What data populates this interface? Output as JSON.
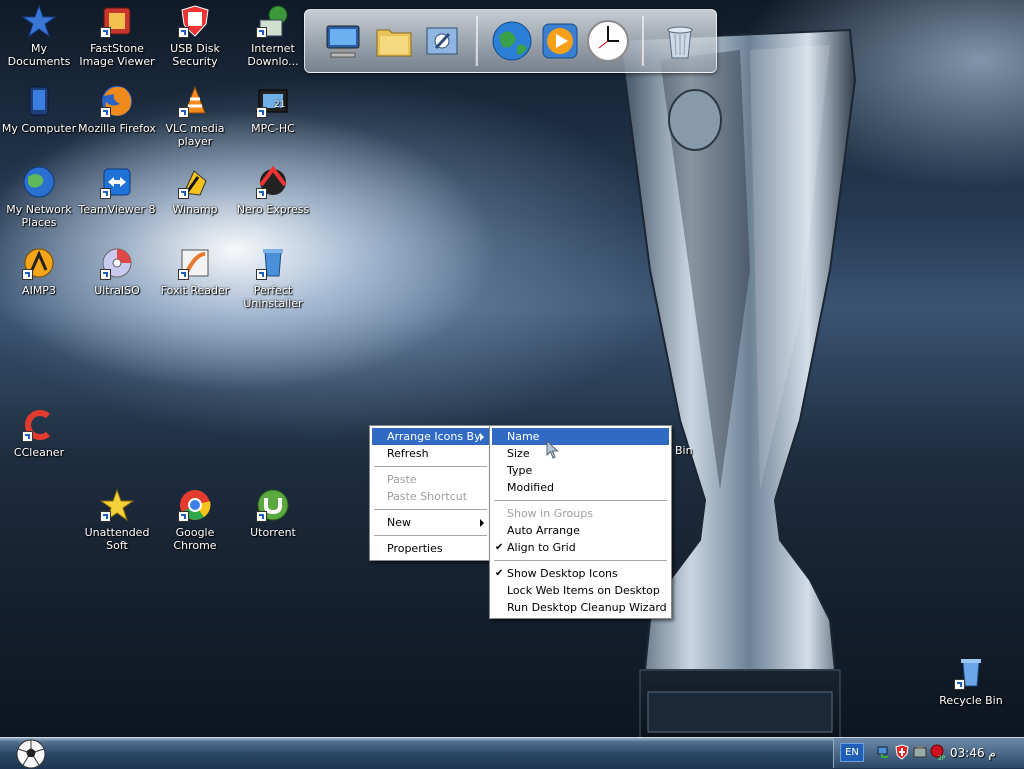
{
  "desktop_icons": [
    {
      "label": "My Documents",
      "icon": "star-icon"
    },
    {
      "label": "FastStone Image Viewer",
      "icon": "image-viewer-icon"
    },
    {
      "label": "USB Disk Security",
      "icon": "shield-icon"
    },
    {
      "label": "Internet Downlo...",
      "icon": "download-globe-icon"
    },
    {
      "label": "My Computer",
      "icon": "computer-icon"
    },
    {
      "label": "Mozilla Firefox",
      "icon": "firefox-icon"
    },
    {
      "label": "VLC media player",
      "icon": "vlc-cone-icon"
    },
    {
      "label": "MPC-HC",
      "icon": "film-icon"
    },
    {
      "label": "My Network Places",
      "icon": "network-globe-icon"
    },
    {
      "label": "TeamViewer 8",
      "icon": "teamviewer-icon"
    },
    {
      "label": "Winamp",
      "icon": "winamp-icon"
    },
    {
      "label": "Nero Express",
      "icon": "nero-icon"
    },
    {
      "label": "AIMP3",
      "icon": "aimp-icon"
    },
    {
      "label": "UltraISO",
      "icon": "disc-icon"
    },
    {
      "label": "Foxit Reader",
      "icon": "foxit-icon"
    },
    {
      "label": "Perfect Uninstaller",
      "icon": "uninstaller-icon"
    },
    {
      "label": "CCleaner",
      "icon": "ccleaner-icon"
    },
    {
      "label": "Unattended Soft",
      "icon": "star-shortcut-icon"
    },
    {
      "label": "Google Chrome",
      "icon": "chrome-icon"
    },
    {
      "label": "Utorrent",
      "icon": "utorrent-icon"
    },
    {
      "label": "Recycle Bin",
      "icon": "recycle-bin-icon"
    }
  ],
  "partial_icon_label": "Bin",
  "dock": {
    "items": [
      "computer-icon",
      "folder-icon",
      "control-panel-icon",
      "globe-icon",
      "media-player-icon",
      "clock-icon",
      "recycle-bin-icon"
    ]
  },
  "context_menu": {
    "items": [
      {
        "label": "Arrange Icons By",
        "state": "highlighted",
        "submenu": true
      },
      {
        "label": "Refresh",
        "state": "enabled"
      },
      {
        "label": "Paste",
        "state": "disabled"
      },
      {
        "label": "Paste Shortcut",
        "state": "disabled"
      },
      {
        "label": "New",
        "state": "enabled",
        "submenu": true
      },
      {
        "label": "Properties",
        "state": "enabled"
      }
    ]
  },
  "submenu": {
    "items": [
      {
        "label": "Name",
        "state": "highlighted"
      },
      {
        "label": "Size",
        "state": "enabled"
      },
      {
        "label": "Type",
        "state": "enabled"
      },
      {
        "label": "Modified",
        "state": "enabled"
      },
      {
        "label": "Show in Groups",
        "state": "disabled"
      },
      {
        "label": "Auto Arrange",
        "state": "enabled"
      },
      {
        "label": "Align to Grid",
        "state": "checked"
      },
      {
        "label": "Show Desktop Icons",
        "state": "checked"
      },
      {
        "label": "Lock Web Items on Desktop",
        "state": "enabled"
      },
      {
        "label": "Run Desktop Cleanup Wizard",
        "state": "enabled"
      }
    ]
  },
  "taskbar": {
    "language": "EN",
    "clock": "03:46 م",
    "tray_icons": [
      "network-icon",
      "antivirus-shield-icon",
      "safely-remove-icon",
      "tray-app-icon"
    ]
  },
  "colors": {
    "menu_highlight": "#316ac5",
    "taskbar": "#2c4866"
  }
}
